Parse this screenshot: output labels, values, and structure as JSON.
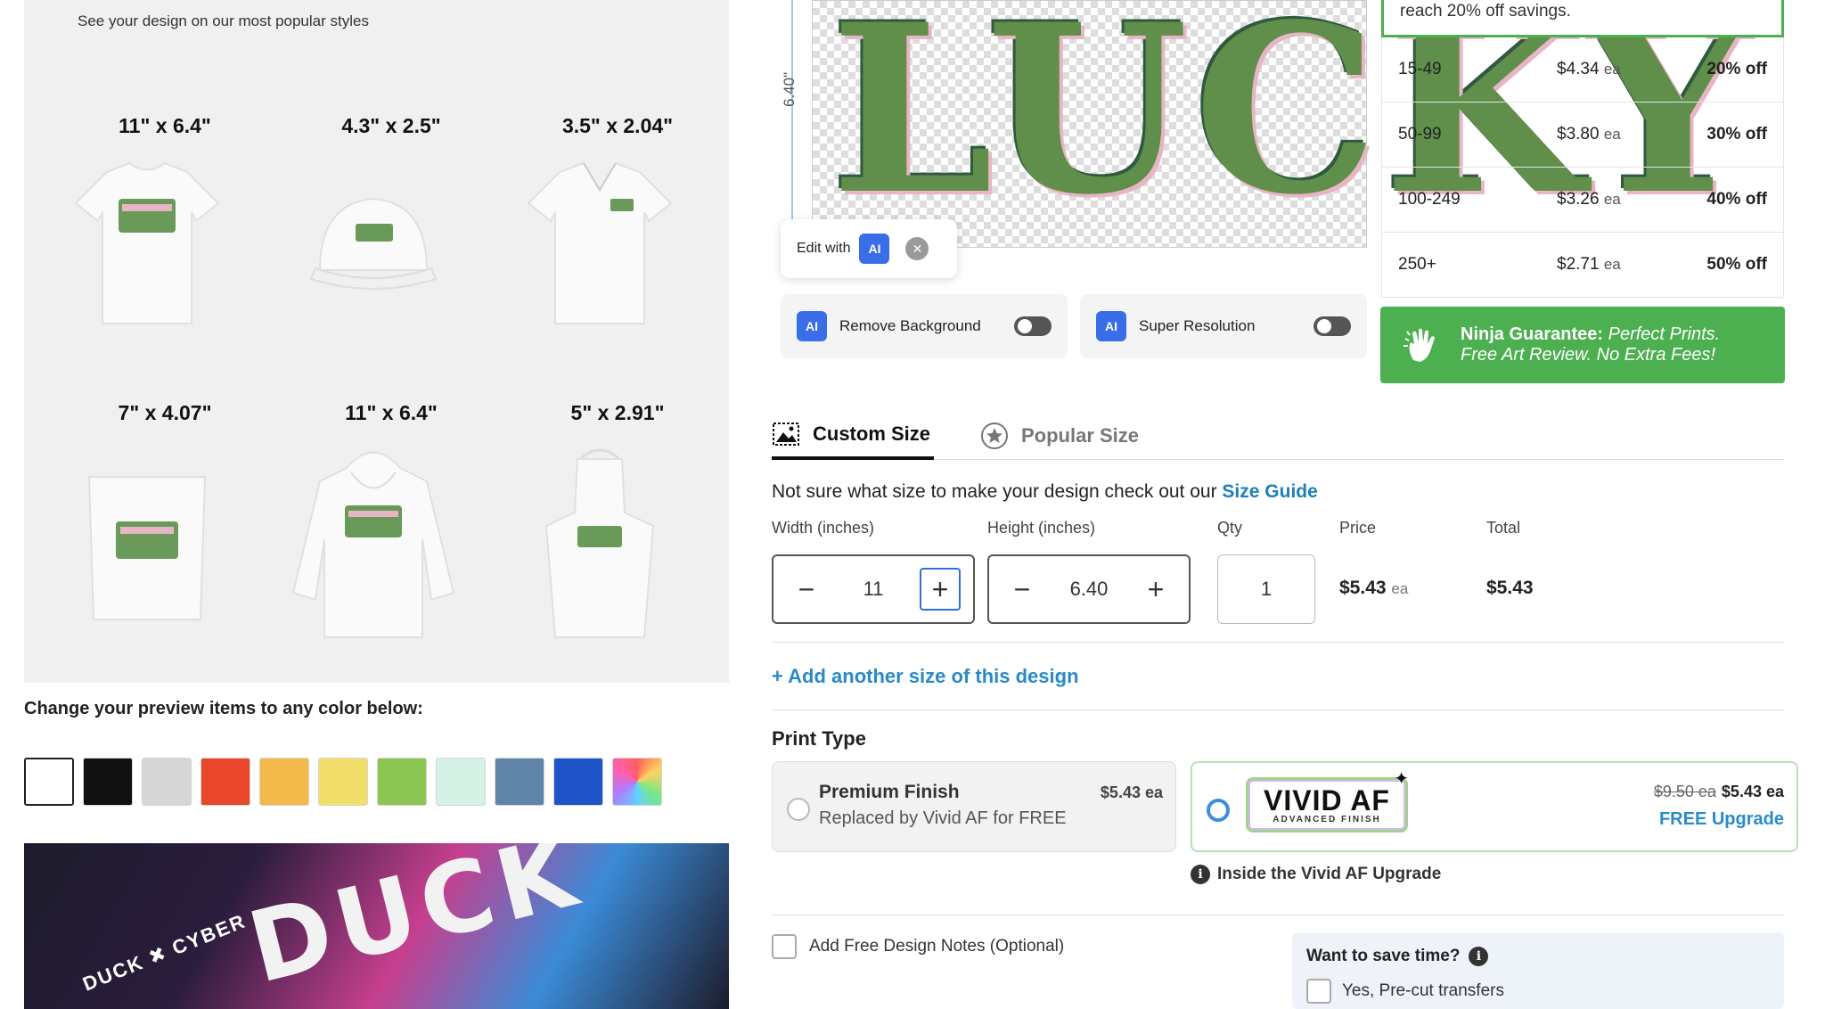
{
  "preview": {
    "subtitle": "See your design on our most popular styles",
    "items": [
      {
        "size": "11\" x 6.4\"",
        "type": "t-shirt"
      },
      {
        "size": "4.3\" x 2.5\"",
        "type": "cap"
      },
      {
        "size": "3.5\" x 2.04\"",
        "type": "polo"
      },
      {
        "size": "7\" x 4.07\"",
        "type": "tote"
      },
      {
        "size": "11\" x 6.4\"",
        "type": "hoodie"
      },
      {
        "size": "5\" x 2.91\"",
        "type": "apron"
      }
    ],
    "color_label": "Change your preview items to any color below:",
    "swatches": [
      "#ffffff",
      "#111111",
      "#d6d6d6",
      "#e8472a",
      "#f3b94a",
      "#f1df6a",
      "#8cc652",
      "#d6f2e6",
      "#5f86a8",
      "#1f54c8",
      "rainbow"
    ],
    "promo_text": "DUCK",
    "promo_sub": "DUCK ✖ CYBER"
  },
  "design": {
    "art_text": "LUCKY",
    "height_label": "6.40\"",
    "edit_with": "Edit with",
    "ai_badge": "AI",
    "remove_bg": "Remove Background",
    "super_res": "Super Resolution"
  },
  "pricing": {
    "banner": "reach 20% off savings.",
    "tiers": [
      {
        "range": "15-49",
        "price": "$4.34",
        "ea": "ea",
        "off": "20% off"
      },
      {
        "range": "50-99",
        "price": "$3.80",
        "ea": "ea",
        "off": "30% off"
      },
      {
        "range": "100-249",
        "price": "$3.26",
        "ea": "ea",
        "off": "40% off"
      },
      {
        "range": "250+",
        "price": "$2.71",
        "ea": "ea",
        "off": "50% off"
      }
    ],
    "ninja_bold": "Ninja Guarantee:",
    "ninja_italic1": "Perfect Prints.",
    "ninja_italic2": "Free Art Review. No Extra Fees!"
  },
  "tabs": {
    "custom": "Custom Size",
    "popular": "Popular Size"
  },
  "size_form": {
    "guide_text": "Not sure what size to make your design check out our ",
    "guide_link": "Size Guide",
    "width_label": "Width (inches)",
    "height_label": "Height (inches)",
    "qty_label": "Qty",
    "price_label": "Price",
    "total_label": "Total",
    "width_value": "11",
    "height_value": "6.40",
    "qty_value": "1",
    "price_value": "$5.43",
    "price_ea": "ea",
    "total_value": "$5.43",
    "add_size": "+ Add another size of this design"
  },
  "print_type": {
    "label": "Print Type",
    "premium_title": "Premium Finish",
    "premium_sub": "Replaced by Vivid AF for FREE",
    "premium_price": "$5.43 ea",
    "vivid_logo": "VIVID AF",
    "vivid_logo_sub": "ADVANCED FINISH",
    "vivid_old_price": "$9.50 ea",
    "vivid_price": "$5.43 ea",
    "vivid_upgrade": "FREE Upgrade",
    "inside_link": "Inside the Vivid AF Upgrade"
  },
  "notes": {
    "label": "Add Free Design Notes (Optional)"
  },
  "save_time": {
    "title": "Want to save time?",
    "option": "Yes, Pre-cut transfers"
  }
}
